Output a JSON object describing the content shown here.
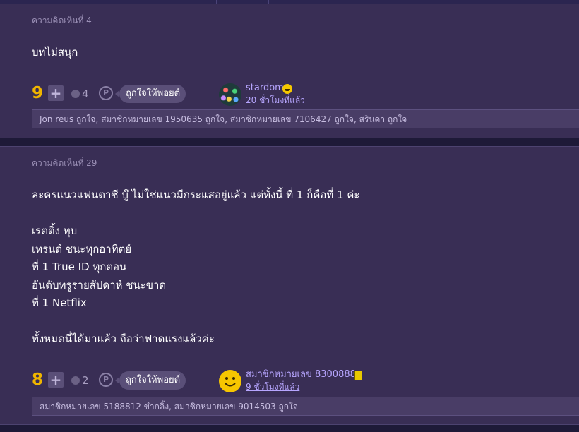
{
  "comments": [
    {
      "number_label": "ความคิดเห็นที่ 4",
      "body": "บทไม่สนุก",
      "score": "9",
      "plus_symbol": "+",
      "emotion_count": "4",
      "like_button_label": "ถูกใจให้พอยต์",
      "user_name": "stardom",
      "time_ago": "20 ชั่วโมงที่แล้ว",
      "reactions_text": "Jon reus ถูกใจ, สมาชิกหมายเลข 1950635 ถูกใจ, สมาชิกหมายเลข 7106427 ถูกใจ, สรินดา ถูกใจ",
      "user_badge_icon": "grin-emoji-icon",
      "avatar_icon": "colorful-dots-avatar"
    },
    {
      "number_label": "ความคิดเห็นที่ 29",
      "body": "ละครแนวแฟนตาซี บู๊ ไม่ใช่แนวมีกระแสอยู่แล้ว แต่ทั้งนี้ ที่ 1 ก็คือที่ 1 ค่ะ\n\nเรตติ้ง ทุบ\nเทรนด์ ชนะทุกอาทิตย์\nที่ 1 True ID ทุกตอน\nอันดับทรูรายสัปดาห์ ชนะขาด\nที่ 1 Netflix\n\nทั้งหมดนี่ได้มาแล้ว ถือว่าฟาดแรงแล้วค่ะ",
      "score": "8",
      "plus_symbol": "+",
      "emotion_count": "2",
      "like_button_label": "ถูกใจให้พอยต์",
      "user_name": "สมาชิกหมายเลข 8300888",
      "time_ago": "9 ชั่วโมงที่แล้ว",
      "reactions_text": "สมาชิกหมายเลข 5188812 ขำกลิ้ง, สมาชิกหมายเลข 9014503 ถูกใจ",
      "user_badge_icon": "id-card-icon",
      "avatar_icon": "smiley-avatar"
    }
  ],
  "colors": {
    "page_bg": "#1e1a38",
    "card_bg": "#392e55",
    "score": "#f0b500",
    "link": "#b7a6ff"
  }
}
